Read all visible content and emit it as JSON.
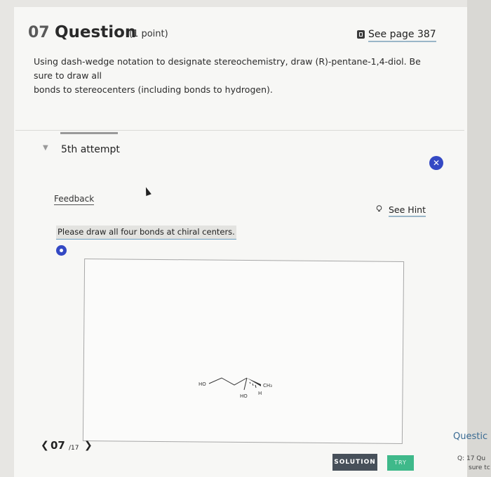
{
  "question": {
    "number": "07",
    "title": "Question",
    "points": "(1 point)",
    "page_link": "See page 387",
    "body_line1": "Using dash-wedge notation to designate stereochemistry, draw (R)-pentane-1,4-diol. Be sure to draw all",
    "body_line2": "bonds to stereocenters (including bonds to hydrogen)."
  },
  "attempt": {
    "label": "5th attempt"
  },
  "feedback": {
    "label": "Feedback",
    "hint": "See Hint",
    "message": "Please draw all four bonds at chiral centers."
  },
  "molecule": {
    "label_ho_left": "HO",
    "label_ho_bottom": "HO",
    "label_ch3": "CH₃",
    "label_h": "H"
  },
  "nav": {
    "current": "07",
    "total": "/17"
  },
  "buttons": {
    "solution": "SOLUTION",
    "try": "TRY"
  },
  "side_panel": {
    "title": "Questic",
    "item": "Q: 17 Qu",
    "sub": "sure tc"
  },
  "colors": {
    "accent_blue": "#3449c4",
    "try_green": "#3fb98a",
    "solution_dark": "#47505a",
    "link_underline": "#9ab6c8"
  }
}
